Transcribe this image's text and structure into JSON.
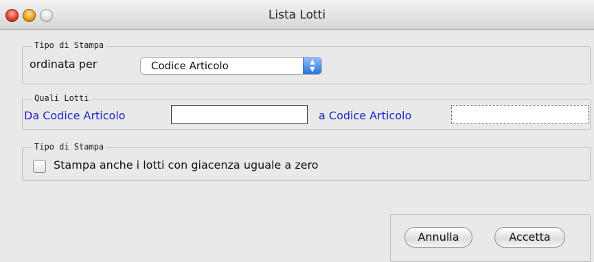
{
  "window": {
    "title": "Lista Lotti"
  },
  "sections": {
    "ordering": {
      "legend": "Tipo di Stampa",
      "label": "ordinata per",
      "select_value": "Codice Articolo"
    },
    "range": {
      "legend": "Quali Lotti",
      "from_label": "Da Codice Articolo",
      "from_value": "",
      "to_label": "a Codice Articolo",
      "to_value": ""
    },
    "options": {
      "legend": "Tipo di Stampa",
      "checkbox_label": "Stampa anche i lotti con giacenza uguale a zero",
      "checked": false
    }
  },
  "buttons": {
    "cancel": "Annulla",
    "accept": "Accetta"
  },
  "colors": {
    "accent": "#2222c8",
    "select_arrow": "#2b73d8"
  }
}
